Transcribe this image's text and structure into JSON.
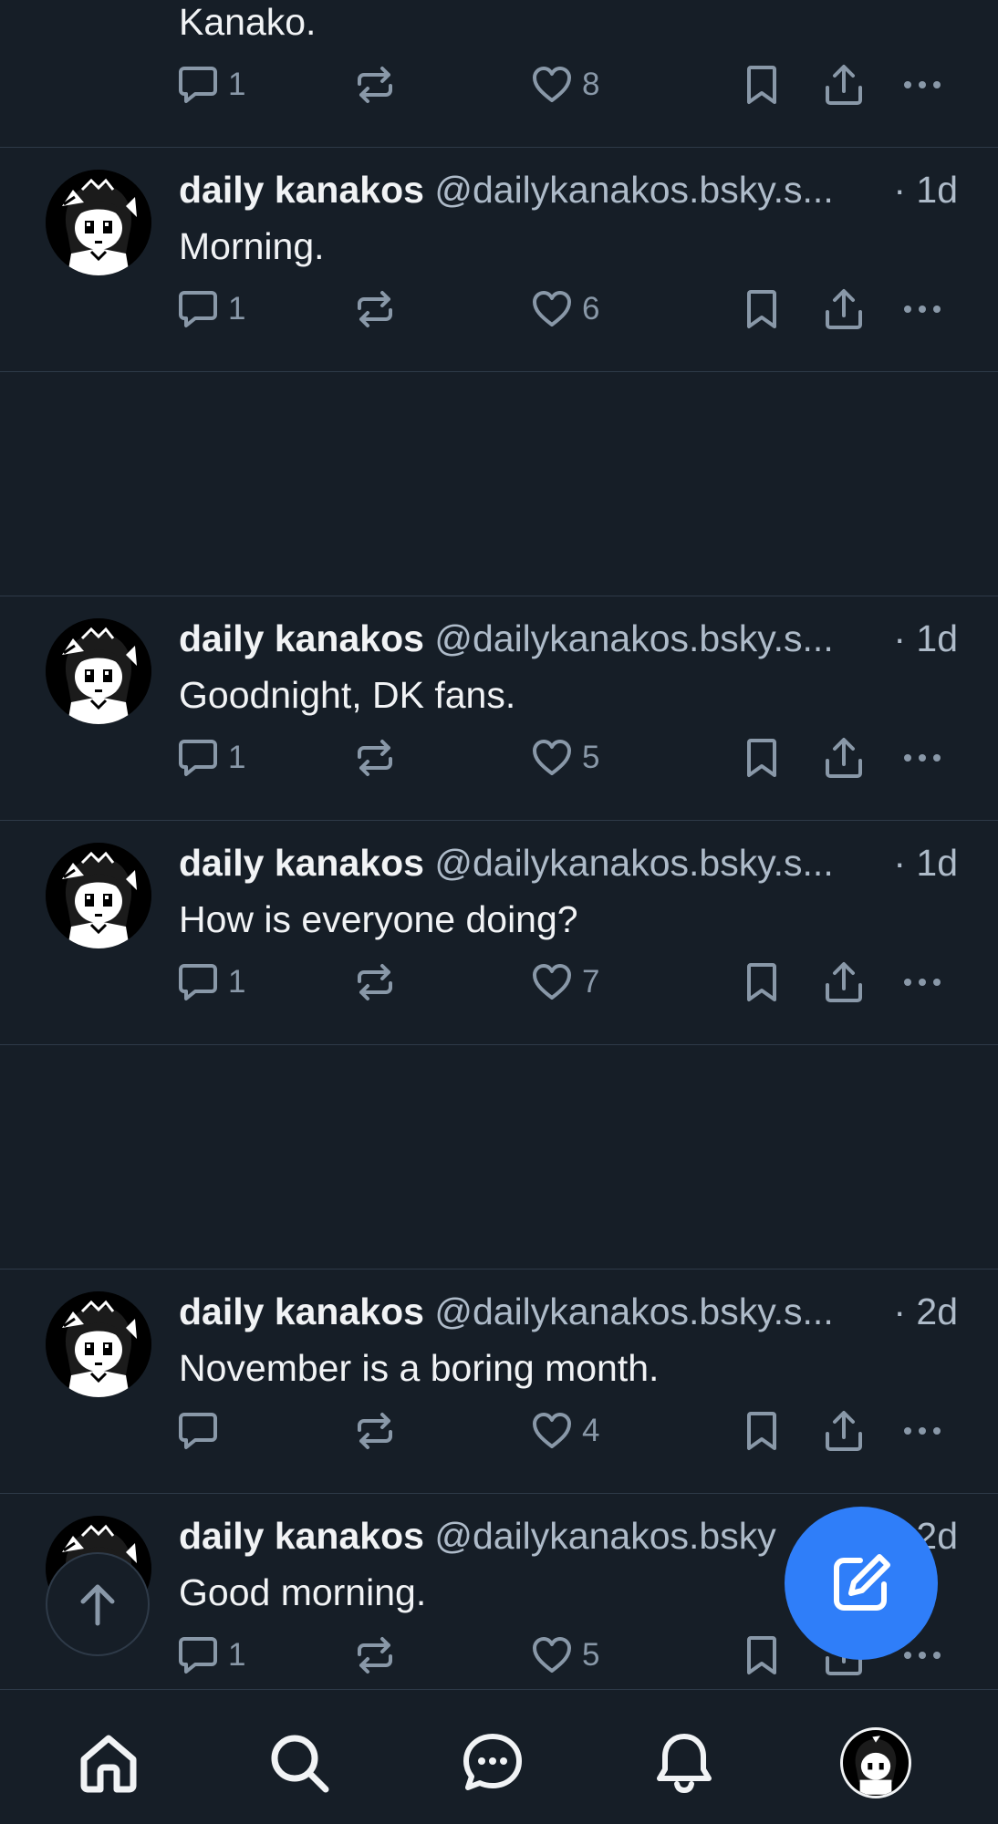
{
  "feed": {
    "partial_post": {
      "text": "Kanako.",
      "reply_count": "1",
      "like_count": "8"
    },
    "posts": [
      {
        "name": "daily kanakos",
        "handle": "@dailykanakos.bsky.s...",
        "time": "· 1d",
        "text": "Morning.",
        "reply_count": "1",
        "like_count": "6"
      },
      {
        "name": "daily kanakos",
        "handle": "@dailykanakos.bsky.s...",
        "time": "· 1d",
        "text": "Goodnight, DK fans.",
        "reply_count": "1",
        "like_count": "5"
      },
      {
        "name": "daily kanakos",
        "handle": "@dailykanakos.bsky.s...",
        "time": "· 1d",
        "text": "How is everyone doing?",
        "reply_count": "1",
        "like_count": "7"
      },
      {
        "name": "daily kanakos",
        "handle": "@dailykanakos.bsky.s...",
        "time": "· 2d",
        "text": "November is a boring month.",
        "reply_count": "",
        "like_count": "4"
      },
      {
        "name": "daily kanakos",
        "handle": "@dailykanakos.bsky",
        "time": "2d",
        "text": "Good morning.",
        "reply_count": "1",
        "like_count": "5"
      }
    ]
  },
  "icons": {
    "reply": "speech-bubble-icon",
    "repost": "repost-arrows-icon",
    "like": "heart-icon",
    "bookmark": "bookmark-icon",
    "share": "share-upload-icon",
    "more": "ellipsis-icon",
    "scroll_top": "arrow-up-icon",
    "compose": "compose-pencil-icon"
  },
  "bottom_nav": [
    "home-icon",
    "search-icon",
    "chat-icon",
    "notifications-bell-icon",
    "profile-avatar"
  ],
  "colors": {
    "background": "#161e27",
    "divider": "#2e3a48",
    "text": "#f1f3f5",
    "muted": "#aebbc9",
    "icon": "#8998a8",
    "accent": "#2f7ef9"
  }
}
